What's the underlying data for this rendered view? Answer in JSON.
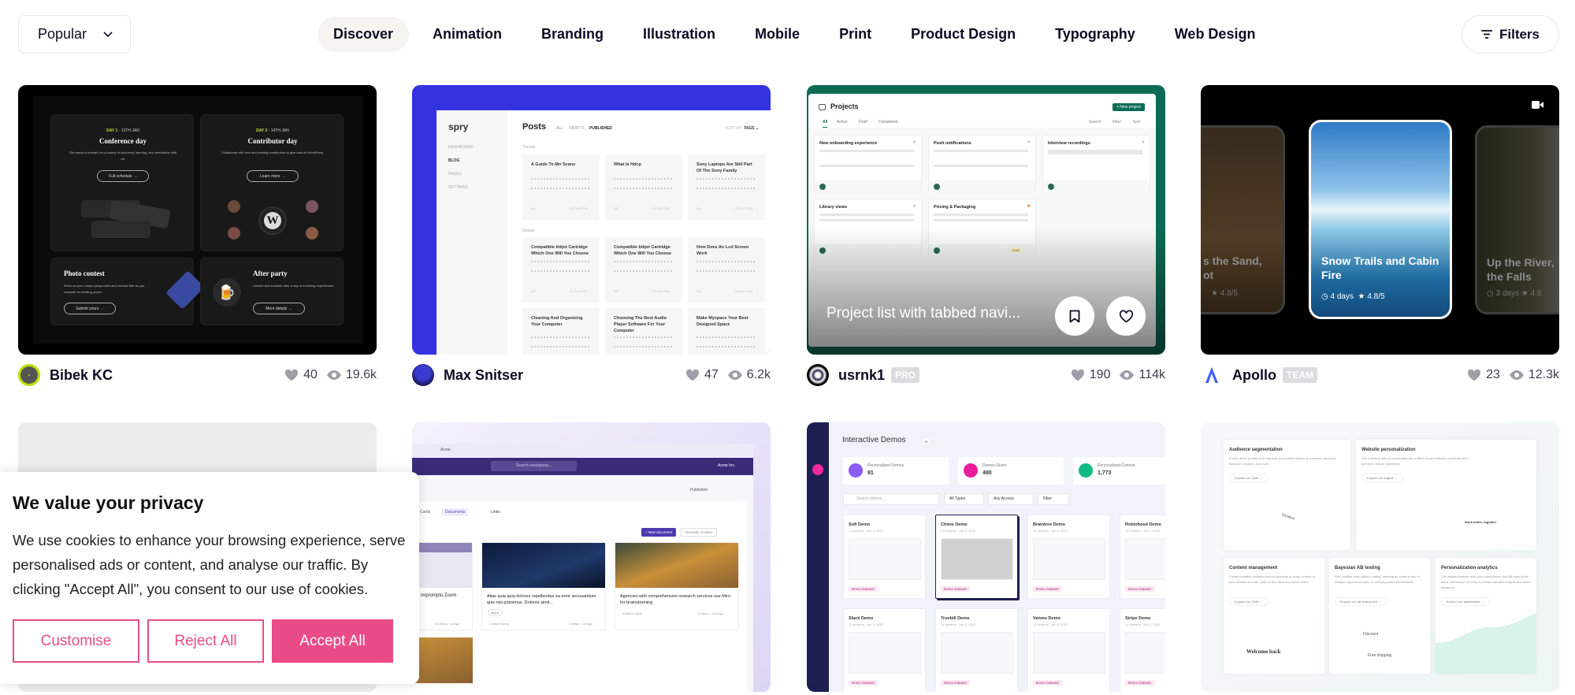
{
  "sort": {
    "label": "Popular"
  },
  "nav": {
    "tabs": [
      "Discover",
      "Animation",
      "Branding",
      "Illustration",
      "Mobile",
      "Print",
      "Product Design",
      "Typography",
      "Web Design"
    ],
    "active": "Discover"
  },
  "filters": {
    "label": "Filters"
  },
  "shots": [
    {
      "author": "Bibek KC",
      "badge": "",
      "likes": "40",
      "views": "19.6k",
      "thumb": {
        "day1": "DAY 1",
        "day1_date": " - 13TH JAN",
        "day2": "DAY 2",
        "day2_date": " - 14TH JAN",
        "t1": "Conference day",
        "d1": "Get ready to embark on a journey of discovery, learning, and celebration with us!",
        "b1": "Full schedule →",
        "t2": "Contributor day",
        "d2": "Collaborate with new and existing contributors to give back to WordPress.",
        "b2": "Learn more →",
        "t3": "Photo contest",
        "d3": "Show us your unique perspective and creative flair as you compete for exciting prizes.",
        "b3": "Submit yours →",
        "t4": "After party",
        "d4": "Unwind and socialize after a day of enriching experiences.",
        "b4": "More details →"
      }
    },
    {
      "author": "Max Snitser",
      "badge": "",
      "likes": "47",
      "views": "6.2k",
      "thumb": {
        "logo": "spry",
        "side": [
          "DASHBOARD",
          "BLOG",
          "PAGES",
          "SETTINGS"
        ],
        "title": "Posts",
        "filters": [
          "ALL",
          "DRAFTS",
          "PUBLISHED"
        ],
        "sort": "SORT BY",
        "sort_val": "TAGS ⌄",
        "section1": "Travels",
        "section2": "Design",
        "posts": [
          "A Guide To Mri Scans",
          "What Is Hdcp",
          "Sony Laptops Are Still Part Of The Sony Family",
          "Compatible Inkjet Cartridge Which One Will You Choose",
          "Compatible Inkjet Cartridge Which One Will You Choose",
          "How Does An Lcd Screen Work",
          "Cleaning And Organizing Your Computer",
          "Choosing The Best Audio Player Software For Your Computer",
          "Make Myspace Your Best Designed Space"
        ],
        "post_tag": "UX",
        "post_date": "21 Oct 2018"
      }
    },
    {
      "author": "usrnk1",
      "badge": "PRO",
      "likes": "190",
      "views": "114k",
      "thumb": {
        "title": "Projects",
        "new_btn": "+ New project",
        "tabs": [
          "All",
          "Active",
          "Draft",
          "Completed"
        ],
        "tools": [
          "Search",
          "Filter",
          "Sort"
        ],
        "projects": [
          "New onboarding experience",
          "Push notifications",
          "Interview recordings",
          "Library views",
          "Pricing & Packaging"
        ],
        "draft": "Draft",
        "overlay_title": "Project list with tabbed navi..."
      }
    },
    {
      "author": "Apollo",
      "badge": "TEAM",
      "likes": "23",
      "views": "12.3k",
      "thumb": {
        "left_title": "s the Sand,\not",
        "left_rating": "4.8/5",
        "title": "Snow Trails and Cabin Fire",
        "days": "4 days",
        "rating": "4.8/5",
        "right_title": "Up the River,\nthe Falls",
        "right_days": "3 days",
        "right_rating": "4.8"
      }
    },
    {
      "author": "",
      "thumb": {}
    },
    {
      "thumb": {
        "tab": "Acme",
        "search": "Search workspace...",
        "org": "Acme Inc.",
        "published": "Published",
        "tabs": [
          "Cards",
          "Documents",
          "Links"
        ],
        "new_doc": "+ New document",
        "recent": "Recently created",
        "docs": [
          "impromptu Zoom",
          "Alias quia quia dolores repellendus ea error accusantium quis nisi possimus. Dolores simil...",
          "Agencies with comprehensive research services use Miro for brainstorming"
        ],
        "tag": "zoom",
        "meta1": "16 views · 1d ago",
        "meta2": "4 views · 1w ago",
        "meta3": "0 views · 1mo ago",
        "linked1": "1 linked cards",
        "linked2": "4 linked cards"
      }
    },
    {
      "thumb": {
        "title": "Interactive Demos",
        "count": "35",
        "stats": [
          {
            "label": "Personalized Demos",
            "value": "91"
          },
          {
            "label": "Demos Given",
            "value": "480"
          },
          {
            "label": "Personalized Content",
            "value": "1,773"
          }
        ],
        "search": "Search demos...",
        "selects": [
          "All Types",
          "Any Access",
          "Filter"
        ],
        "demos": [
          "Sofi Demo",
          "Chime Demo",
          "Braintree Demo",
          "Robinhood Demo",
          "Slack Demo",
          "Truebill Demo",
          "Venmo Demo",
          "Stripe Demo"
        ],
        "demo_meta": "12 screens · Jun 3, 2022",
        "dataset": "Demo Dataset"
      }
    },
    {
      "thumb": {
        "features": [
          {
            "title": "Audience segmentation",
            "desc": "Enrich users' profiles and segment your visitors based on interests, browsing behavior, location, and more.",
            "link": "Explore our CMS →"
          },
          {
            "title": "Website personalization",
            "desc": "Use real-time data to personalize the content of your website in minutes and preview it before publishing.",
            "link": "Explore our engine →"
          },
          {
            "title": "Content management",
            "desc": "Create reusable sections and components to serve content to your website at scale, both on the client and server sides.",
            "link": "Explore our CMS →"
          },
          {
            "title": "Bayesian AB testing",
            "desc": "Run multiple tests without coding, needing an external tool to analyze experiment data, or worrying about performance.",
            "link": "Explore our AB testing tool →"
          },
          {
            "title": "Personalization analytics",
            "desc": "Get detailed metrics from your experiences and AB tests in the same dashboard. It's easy to extract valuable insights and make decisions.",
            "link": "Explore our dashboards →"
          }
        ],
        "welcome": "Welcome back",
        "variant_a": "Discount",
        "variant_b": "Free shipping",
        "student": "Student",
        "work": "Work better, together"
      }
    }
  ],
  "cookie": {
    "title": "We value your privacy",
    "body": "We use cookies to enhance your browsing experience, serve personalised ads or content, and analyse our traffic. By clicking \"Accept All\", you consent to our use of cookies.",
    "customise": "Customise",
    "reject": "Reject All",
    "accept": "Accept All"
  },
  "colors": {
    "accent": "#e94c89",
    "card2_bg": "#3333e0",
    "card3_bg": "#0d6b55"
  }
}
